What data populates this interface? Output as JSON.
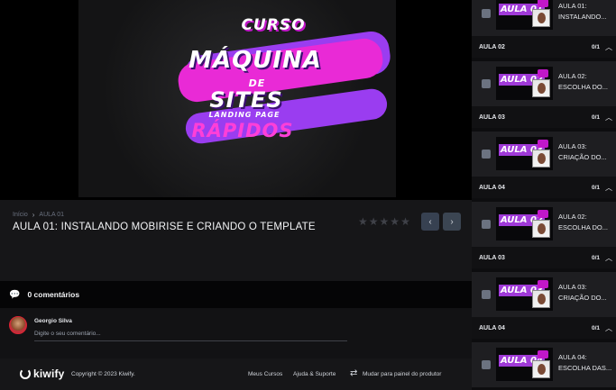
{
  "video": {
    "art": {
      "curso": "CURSO",
      "maquina": "MÁQUINA",
      "de": "DE",
      "sites": "SITES",
      "landing": "LANDING PAGE",
      "rapidos": "RÁPIDOS"
    }
  },
  "breadcrumb": {
    "home": "Início",
    "sep": "›",
    "current": "AULA 01"
  },
  "lesson": {
    "title": "AULA 01: INSTALANDO MOBIRISE E CRIANDO O TEMPLATE",
    "rating_stars": 0,
    "rating_max": 5
  },
  "nav": {
    "prev_icon": "chevron-left-icon",
    "next_icon": "chevron-right-icon",
    "prev_glyph": "‹",
    "next_glyph": "›"
  },
  "comments": {
    "icon": "comments-icon",
    "label": "0 comentários"
  },
  "comment_form": {
    "user_name": "Georgio Silva",
    "placeholder": "Digite o seu comentário..."
  },
  "footer": {
    "logo_text": "kiwify",
    "copyright": "Copyright © 2023 Kiwify.",
    "links": [
      "Meus Cursos",
      "Ajuda & Suporte",
      "Mudar para painel do produtor"
    ]
  },
  "sidebar": {
    "items": [
      {
        "type": "lesson",
        "thumb": "AULA 01",
        "label": "AULA 01: INSTALANDO..."
      },
      {
        "type": "module",
        "title": "AULA 02",
        "count": "0/1"
      },
      {
        "type": "lesson",
        "thumb": "AULA 02",
        "label": "AULA 02: ESCOLHA DO..."
      },
      {
        "type": "module",
        "title": "AULA 03",
        "count": "0/1"
      },
      {
        "type": "lesson",
        "thumb": "AULA 03",
        "label": "AULA 03: CRIAÇÃO DO..."
      },
      {
        "type": "module",
        "title": "AULA 04",
        "count": "0/1"
      },
      {
        "type": "lesson",
        "thumb": "AULA 02",
        "label": "AULA 02: ESCOLHA DO..."
      },
      {
        "type": "module",
        "title": "AULA 03",
        "count": "0/1"
      },
      {
        "type": "lesson",
        "thumb": "AULA 03",
        "label": "AULA 03: CRIAÇÃO DO..."
      },
      {
        "type": "module",
        "title": "AULA 04",
        "count": "0/1"
      },
      {
        "type": "lesson",
        "thumb": "AULA 04",
        "label": "AULA 04: ESCOLHA DAS..."
      }
    ]
  },
  "colors": {
    "accent": "#c117c9",
    "purple": "#9a3df0",
    "background": "#161618"
  }
}
